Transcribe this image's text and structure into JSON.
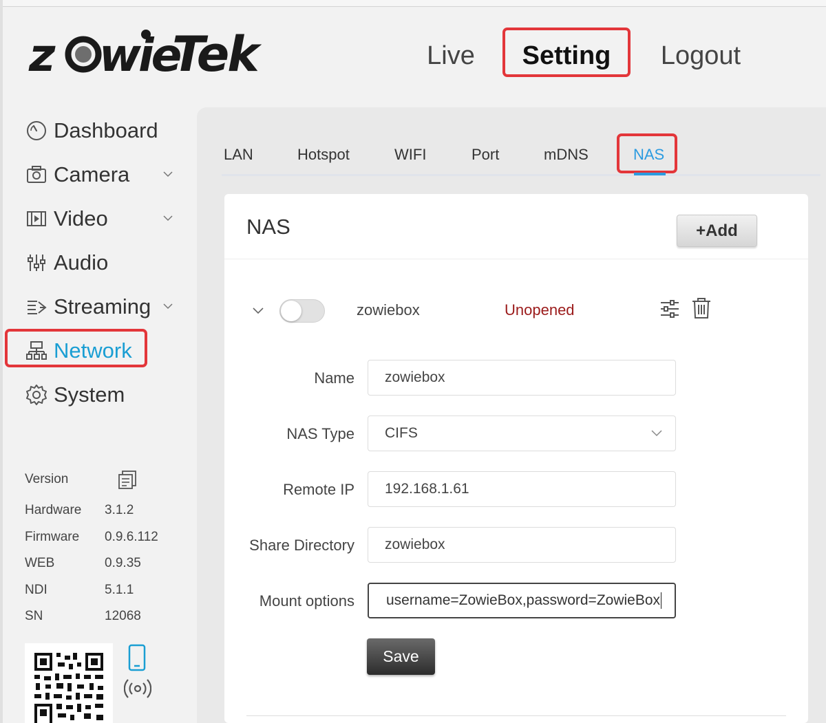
{
  "brand": {
    "logo_text": "zowieTek"
  },
  "top_nav": {
    "live": "Live",
    "setting": "Setting",
    "logout": "Logout"
  },
  "sidebar": {
    "items": [
      {
        "label": "Dashboard",
        "icon": "dashboard-icon",
        "has_submenu": false
      },
      {
        "label": "Camera",
        "icon": "camera-icon",
        "has_submenu": true
      },
      {
        "label": "Video",
        "icon": "video-icon",
        "has_submenu": true
      },
      {
        "label": "Audio",
        "icon": "audio-icon",
        "has_submenu": false
      },
      {
        "label": "Streaming",
        "icon": "streaming-icon",
        "has_submenu": true
      },
      {
        "label": "Network",
        "icon": "network-icon",
        "has_submenu": false,
        "active": true
      },
      {
        "label": "System",
        "icon": "gear-icon",
        "has_submenu": false
      }
    ],
    "version": {
      "title": "Version",
      "rows": [
        {
          "key": "Hardware",
          "value": "3.1.2"
        },
        {
          "key": "Firmware",
          "value": "0.9.6.112"
        },
        {
          "key": "WEB",
          "value": "0.9.35"
        },
        {
          "key": "NDI",
          "value": "5.1.1"
        },
        {
          "key": "SN",
          "value": "12068"
        }
      ]
    }
  },
  "tabs": {
    "lan": "LAN",
    "hotspot": "Hotspot",
    "wifi": "WIFI",
    "port": "Port",
    "mdns": "mDNS",
    "nas": "NAS",
    "active": "NAS"
  },
  "nas": {
    "title": "NAS",
    "add_label": "+Add",
    "entry": {
      "name": "zowiebox",
      "status": "Unopened",
      "enabled": false
    },
    "form": {
      "name_label": "Name",
      "name_value": "zowiebox",
      "type_label": "NAS Type",
      "type_value": "CIFS",
      "ip_label": "Remote IP",
      "ip_value": "192.168.1.61",
      "share_label": "Share Directory",
      "share_value": "zowiebox",
      "mount_label": "Mount options",
      "mount_value": "username=ZowieBox,password=ZowieBox"
    },
    "save_label": "Save"
  },
  "colors": {
    "accent": "#1a9ed3",
    "tab_active": "#2b9be0",
    "highlight_box": "#e3363a",
    "status_unopened": "#9b1b1b"
  }
}
